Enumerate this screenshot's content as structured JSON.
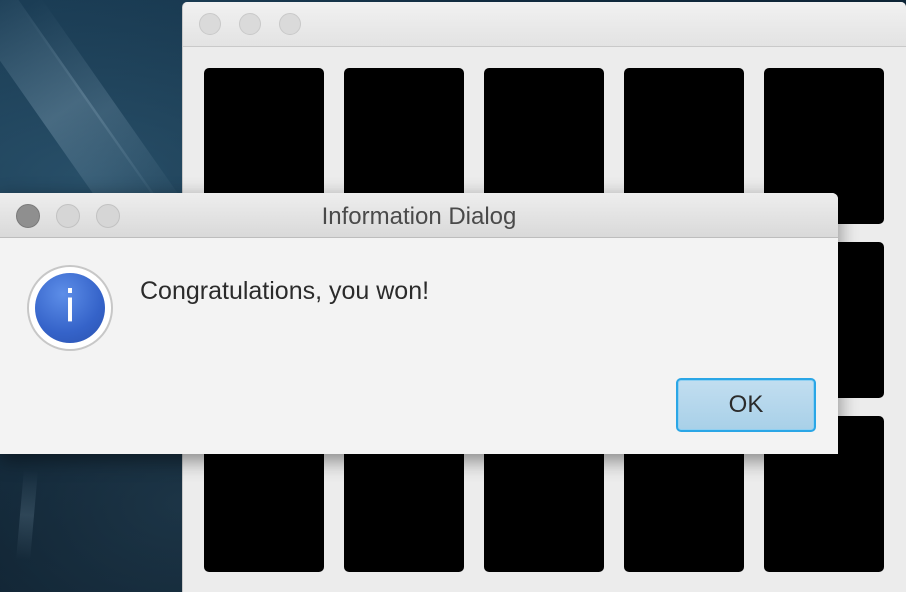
{
  "game_window": {
    "title": "",
    "board": {
      "rows": 3,
      "cols": 5,
      "card_color": "#000000"
    }
  },
  "dialog": {
    "title": "Information Dialog",
    "message": "Congratulations, you won!",
    "icon": "info-icon",
    "icon_glyph": "i",
    "ok_label": "OK",
    "accent_color": "#2aa6e6"
  }
}
